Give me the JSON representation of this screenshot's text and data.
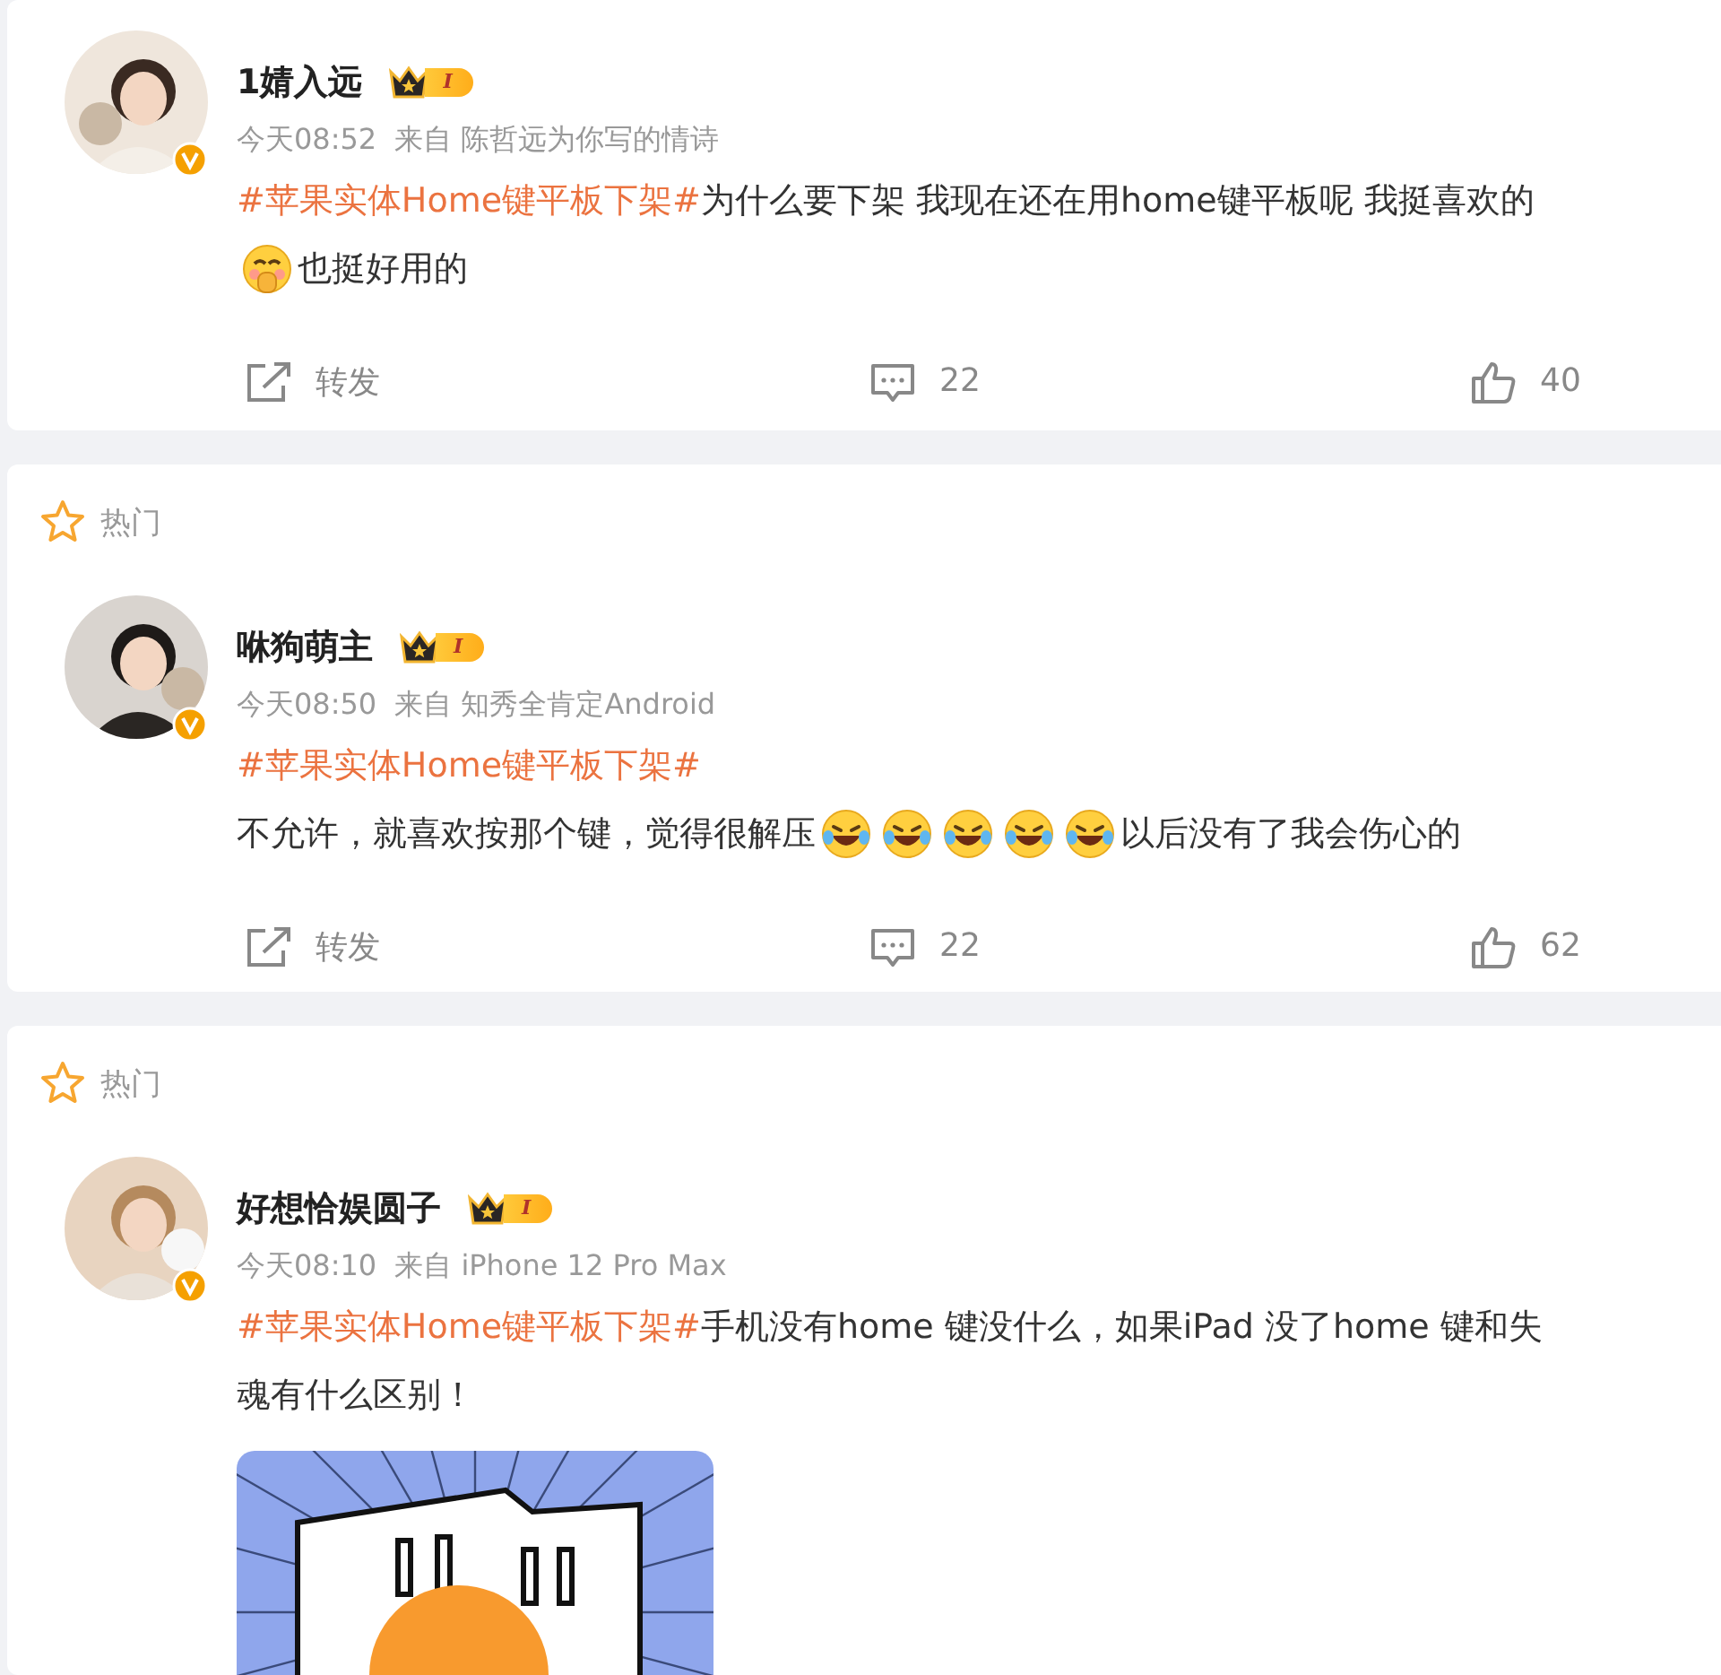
{
  "posts": [
    {
      "user": {
        "name": "1婧入远",
        "level": "I"
      },
      "time": "今天08:52",
      "source": "来自 陈哲远为你写的情诗",
      "lines": [
        [
          {
            "kind": "topic",
            "text": "#苹果实体Home键平板下架#"
          },
          {
            "kind": "text",
            "text": "为什么要下架 我现在还在用home键平板呢 我挺喜欢的"
          }
        ],
        [
          {
            "kind": "shy_emoji"
          },
          {
            "kind": "text",
            "text": "也挺好用的"
          }
        ]
      ],
      "image": false,
      "actions": {
        "repost": "转发",
        "comments": "22",
        "likes": "40"
      }
    },
    {
      "hot": "热门",
      "user": {
        "name": "咻狗萌主",
        "level": "I"
      },
      "time": "今天08:50",
      "source": "来自 知秀全肯定Android",
      "lines": [
        [
          {
            "kind": "topic",
            "text": "#苹果实体Home键平板下架#"
          }
        ],
        [
          {
            "kind": "text",
            "text": "不允许，就喜欢按那个键，觉得很解压"
          },
          {
            "kind": "laugh_emoji"
          },
          {
            "kind": "laugh_emoji"
          },
          {
            "kind": "laugh_emoji"
          },
          {
            "kind": "laugh_emoji"
          },
          {
            "kind": "laugh_emoji"
          },
          {
            "kind": "text",
            "text": "以后没有了我会伤心的"
          }
        ]
      ],
      "image": false,
      "actions": {
        "repost": "转发",
        "comments": "22",
        "likes": "62"
      }
    },
    {
      "hot": "热门",
      "user": {
        "name": "好想恰娱圆子",
        "level": "I"
      },
      "time": "今天08:10",
      "source": "来自 iPhone 12 Pro Max",
      "lines": [
        [
          {
            "kind": "topic",
            "text": "#苹果实体Home键平板下架#"
          },
          {
            "kind": "text",
            "text": "手机没有home 键没什么，如果iPad 没了home 键和失"
          }
        ],
        [
          {
            "kind": "text",
            "text": "魂有什么区别！"
          }
        ]
      ],
      "image": true
    }
  ]
}
